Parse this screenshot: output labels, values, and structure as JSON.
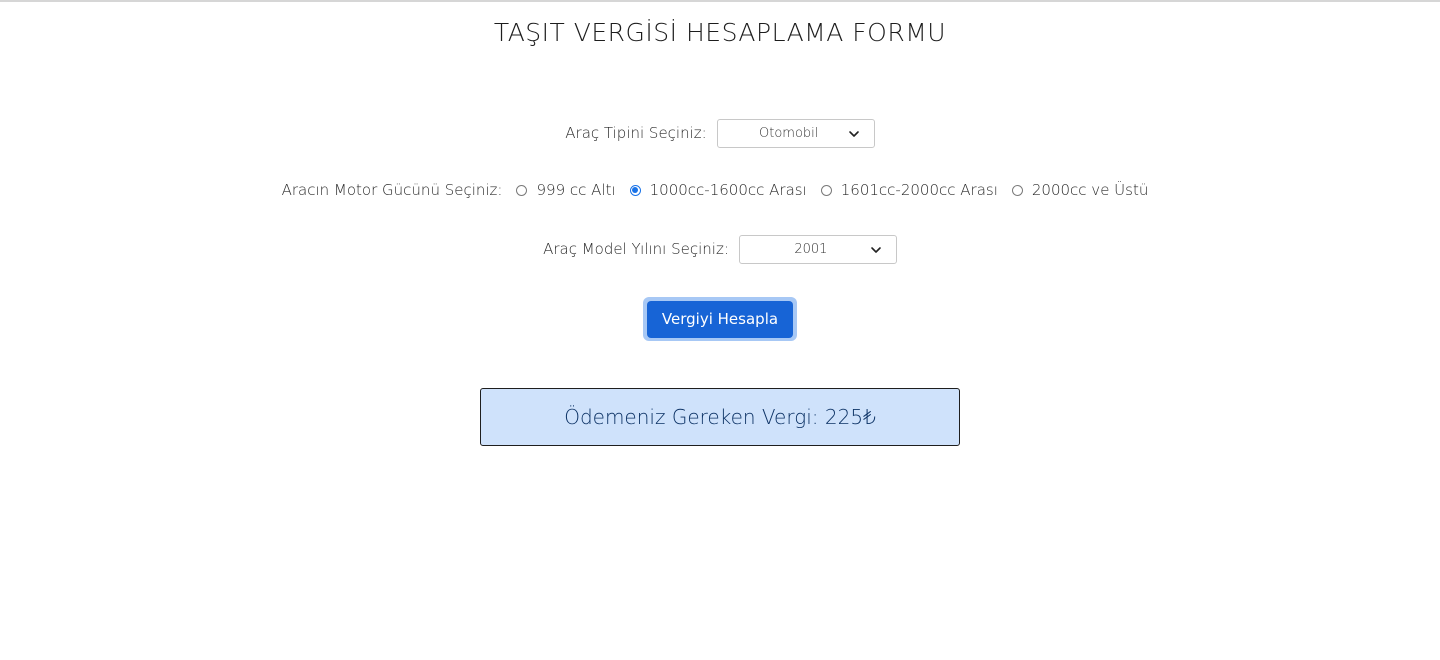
{
  "title": "TAŞIT VERGİSİ HESAPLAMA FORMU",
  "vehicle_type": {
    "label": "Araç Tipini Seçiniz:",
    "selected": "Otomobil"
  },
  "engine": {
    "label": "Aracın Motor Gücünü Seçiniz:",
    "options": [
      {
        "label": "999 cc Altı",
        "checked": false
      },
      {
        "label": "1000cc-1600cc Arası",
        "checked": true
      },
      {
        "label": "1601cc-2000cc Arası",
        "checked": false
      },
      {
        "label": "2000cc ve Üstü",
        "checked": false
      }
    ]
  },
  "model_year": {
    "label": "Araç Model Yılını Seçiniz:",
    "selected": "2001"
  },
  "calculate_button": "Vergiyi Hesapla",
  "result": {
    "text": "Ödemeniz Gereken Vergi: 225₺"
  },
  "colors": {
    "button": "#1764d6",
    "button_focus_ring": "#a7c8f5",
    "result_background": "#cfe2fb",
    "radio_checked": "#1a73e8"
  },
  "icons": {
    "dropdown": "chevron-down-icon"
  }
}
